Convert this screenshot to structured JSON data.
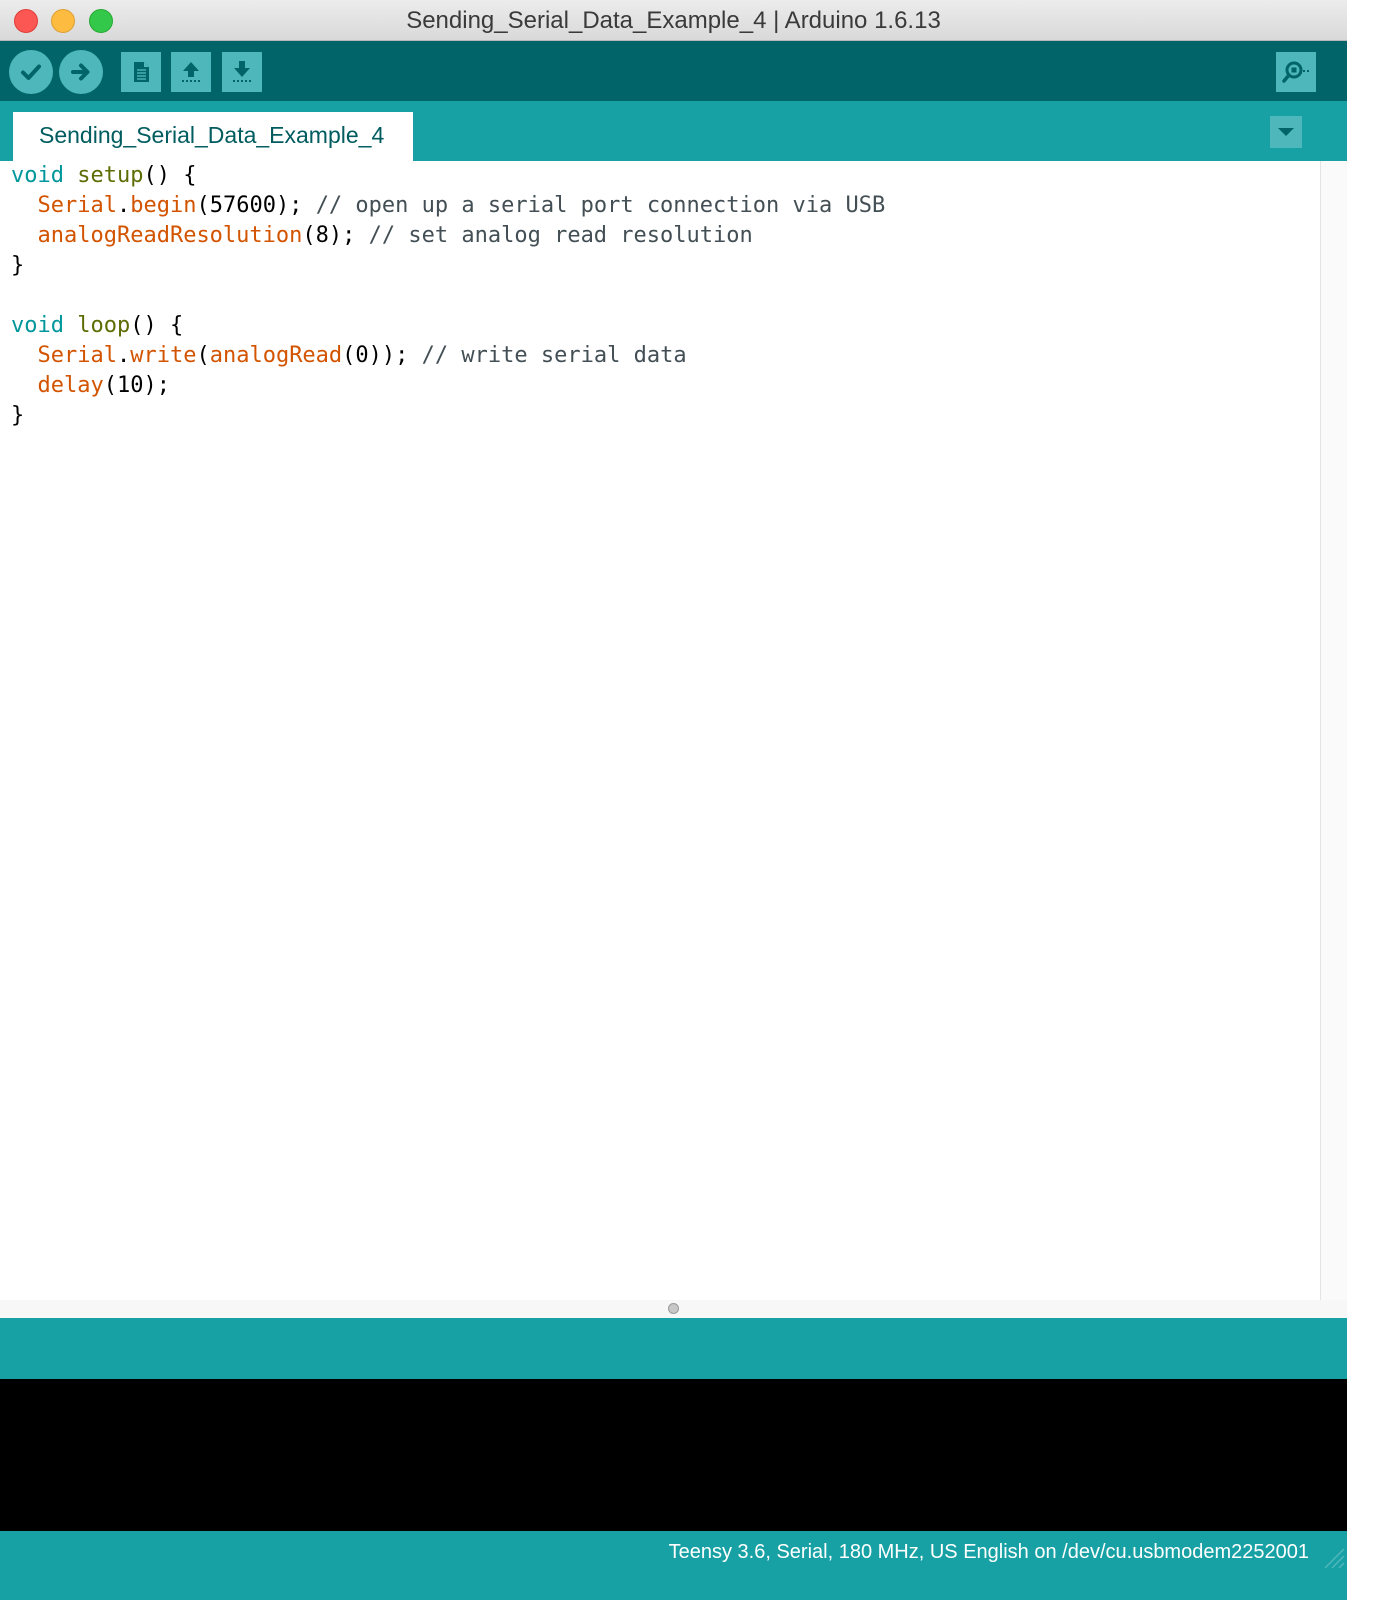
{
  "window": {
    "title": "Sending_Serial_Data_Example_4 | Arduino 1.6.13"
  },
  "toolbar": {
    "buttons": [
      {
        "name": "verify",
        "icon": "checkmark-icon"
      },
      {
        "name": "upload",
        "icon": "arrow-right-icon"
      },
      {
        "name": "new",
        "icon": "new-file-icon"
      },
      {
        "name": "open",
        "icon": "arrow-up-icon"
      },
      {
        "name": "save",
        "icon": "arrow-down-icon"
      }
    ],
    "serial_monitor_icon": "magnifier-icon"
  },
  "tabs": [
    {
      "label": "Sending_Serial_Data_Example_4",
      "active": true
    }
  ],
  "editor": {
    "lines": [
      [
        {
          "t": "void",
          "c": "kw"
        },
        {
          "t": " "
        },
        {
          "t": "setup",
          "c": "fn"
        },
        {
          "t": "() {"
        }
      ],
      [
        {
          "t": "  "
        },
        {
          "t": "Serial",
          "c": "lib"
        },
        {
          "t": "."
        },
        {
          "t": "begin",
          "c": "lib"
        },
        {
          "t": "(57600); "
        },
        {
          "t": "// open up a serial port connection via USB",
          "c": "cm"
        }
      ],
      [
        {
          "t": "  "
        },
        {
          "t": "analogReadResolution",
          "c": "lib"
        },
        {
          "t": "(8); "
        },
        {
          "t": "// set analog read resolution",
          "c": "cm"
        }
      ],
      [
        {
          "t": "}"
        }
      ],
      [
        {
          "t": ""
        }
      ],
      [
        {
          "t": "void",
          "c": "kw"
        },
        {
          "t": " "
        },
        {
          "t": "loop",
          "c": "fn"
        },
        {
          "t": "() {"
        }
      ],
      [
        {
          "t": "  "
        },
        {
          "t": "Serial",
          "c": "lib"
        },
        {
          "t": "."
        },
        {
          "t": "write",
          "c": "lib"
        },
        {
          "t": "("
        },
        {
          "t": "analogRead",
          "c": "lib"
        },
        {
          "t": "(0)); "
        },
        {
          "t": "// write serial data",
          "c": "cm"
        }
      ],
      [
        {
          "t": "  "
        },
        {
          "t": "delay",
          "c": "lib"
        },
        {
          "t": "(10);"
        }
      ],
      [
        {
          "t": "}"
        }
      ]
    ]
  },
  "footer": {
    "board_info": "Teensy 3.6, Serial, 180 MHz, US English on /dev/cu.usbmodem2252001"
  },
  "colors": {
    "toolbar": "#006468",
    "tabstrip": "#17a1a5",
    "button": "#4db7bb",
    "keyword": "#00979c",
    "function": "#5e6d03",
    "library": "#d35400",
    "comment": "#434f54"
  }
}
